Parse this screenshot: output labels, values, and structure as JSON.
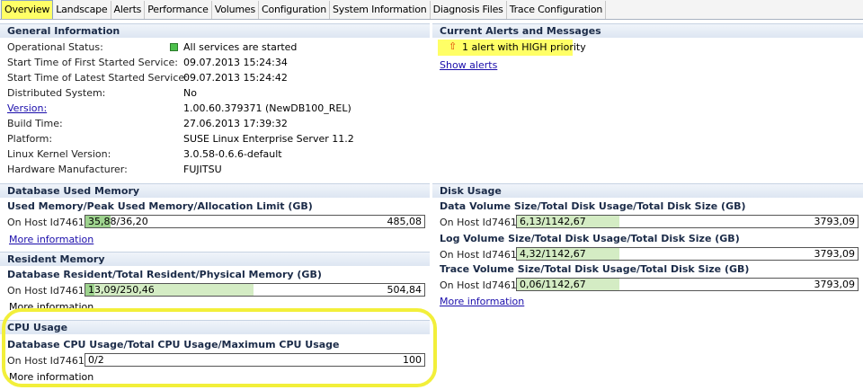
{
  "tabs": [
    "Overview",
    "Landscape",
    "Alerts",
    "Performance",
    "Volumes",
    "Configuration",
    "System Information",
    "Diagnosis Files",
    "Trace Configuration"
  ],
  "general": {
    "title": "General Information",
    "rows": [
      {
        "label": "Operational Status:",
        "value": "All services are started"
      },
      {
        "label": "Start Time of First Started Service:",
        "value": "09.07.2013 15:24:34"
      },
      {
        "label": "Start Time of Latest Started Service:",
        "value": "09.07.2013 15:24:42"
      },
      {
        "label": "Distributed System:",
        "value": "No"
      },
      {
        "label": "Version:",
        "value": "1.00.60.379371 (NewDB100_REL)"
      },
      {
        "label": "Build Time:",
        "value": "27.06.2013 17:39:32"
      },
      {
        "label": "Platform:",
        "value": "SUSE Linux Enterprise Server 11.2"
      },
      {
        "label": "Linux Kernel Version:",
        "value": "3.0.58-0.6.6-default"
      },
      {
        "label": "Hardware Manufacturer:",
        "value": "FUJITSU"
      }
    ]
  },
  "alerts": {
    "title": "Current Alerts and Messages",
    "message": "1 alert with HIGH priority",
    "link": "Show alerts"
  },
  "db_memory": {
    "title": "Database Used Memory",
    "subtitle": "Used Memory/Peak Used Memory/Allocation Limit (GB)",
    "host": "On Host Id7461:",
    "used": "35,88",
    "bar_text": "/36,20",
    "max": "485,08",
    "used_fraction": 0.074,
    "peak_fraction": 0.0746,
    "more": "More information"
  },
  "resident": {
    "title": "Resident Memory",
    "subtitle": "Database Resident/Total Resident/Physical Memory (GB)",
    "host": "On Host Id7461:",
    "bar_text": "13,09/250,46",
    "max": "504,84",
    "db_fraction": 0.026,
    "total_fraction": 0.496,
    "more": "More information"
  },
  "cpu": {
    "title": "CPU Usage",
    "subtitle": "Database CPU Usage/Total CPU Usage/Maximum CPU Usage",
    "host": "On Host Id7461:",
    "bar_text": "0/2",
    "max": "100",
    "more": "More information"
  },
  "disk": {
    "title": "Disk Usage",
    "sections": [
      {
        "subtitle": "Data Volume Size/Total Disk Usage/Total Disk Size (GB)",
        "host": "On Host Id7461:",
        "bar_text": "6,13/1142,67",
        "max": "3793,09",
        "fraction": 0.301
      },
      {
        "subtitle": "Log Volume Size/Total Disk Usage/Total Disk Size (GB)",
        "host": "On Host Id7461:",
        "bar_text": "4,32/1142,67",
        "max": "3793,09",
        "fraction": 0.301
      },
      {
        "subtitle": "Trace Volume Size/Total Disk Usage/Total Disk Size (GB)",
        "host": "On Host Id7461:",
        "bar_text": "0,06/1142,67",
        "max": "3793,09",
        "fraction": 0.301
      }
    ],
    "more": "More information"
  }
}
